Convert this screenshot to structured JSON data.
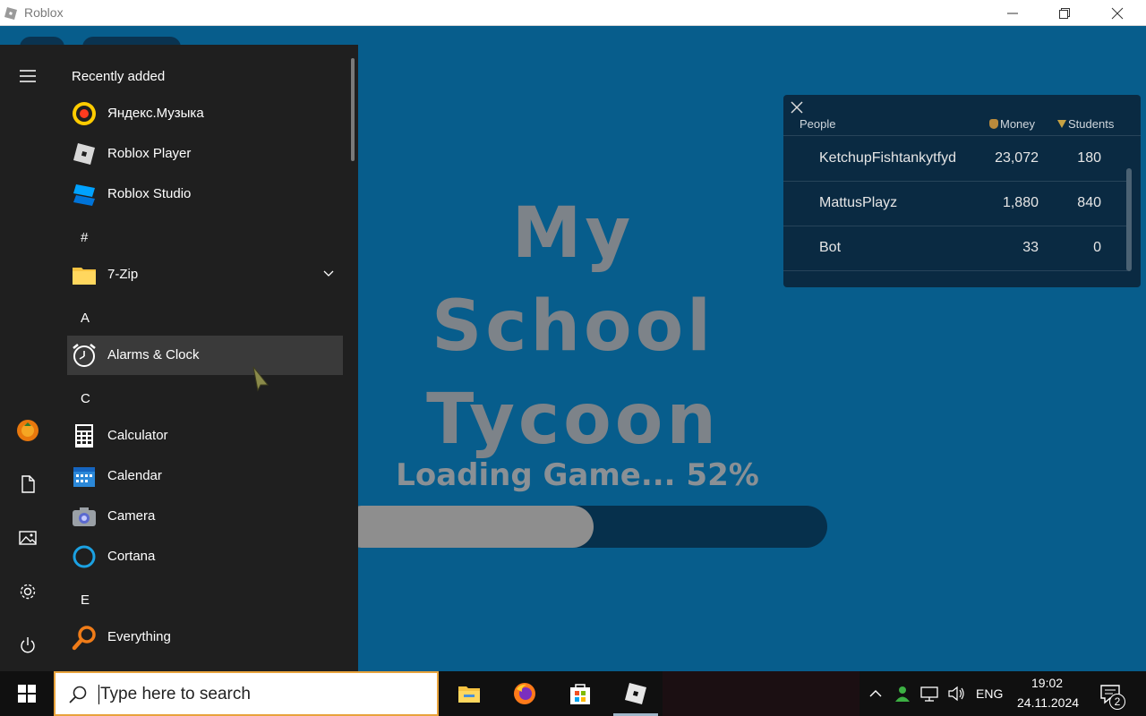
{
  "window": {
    "title": "Roblox",
    "minimize_icon": "minimize-icon",
    "restore_icon": "restore-icon",
    "close_icon": "close-icon"
  },
  "game": {
    "title_line1": "My School",
    "title_line2": "Tycoon",
    "loading_text": "Loading Game... 52%",
    "progress_fraction": 0.52,
    "colors": {
      "background": "#075d8c",
      "progress_fill": "#8e8e8e",
      "progress_track": "#06304c"
    }
  },
  "leaderboard": {
    "headers": {
      "people": "People",
      "money": "Money",
      "students": "Students"
    },
    "rows": [
      {
        "name": "KetchupFishtankytfyd",
        "money": "23,072",
        "students": "180"
      },
      {
        "name": "MattusPlayz",
        "money": "1,880",
        "students": "840"
      },
      {
        "name": "Bot",
        "money": "33",
        "students": "0"
      }
    ]
  },
  "start_menu": {
    "section_title": "Recently added",
    "letters": [
      "#",
      "A",
      "C",
      "E"
    ],
    "apps": [
      {
        "label": "Яндекс.Музыка",
        "icon": "yandex-music-icon"
      },
      {
        "label": "Roblox Player",
        "icon": "roblox-player-icon"
      },
      {
        "label": "Roblox Studio",
        "icon": "roblox-studio-icon"
      },
      {
        "label": "7-Zip",
        "icon": "folder-icon"
      },
      {
        "label": "Alarms & Clock",
        "icon": "alarm-clock-icon"
      },
      {
        "label": "Calculator",
        "icon": "calculator-icon"
      },
      {
        "label": "Calendar",
        "icon": "calendar-icon"
      },
      {
        "label": "Camera",
        "icon": "camera-icon"
      },
      {
        "label": "Cortana",
        "icon": "cortana-icon"
      },
      {
        "label": "Everything",
        "icon": "everything-search-icon"
      }
    ],
    "rail": [
      "hamburger-icon",
      "user-avatar",
      "documents-icon",
      "pictures-icon",
      "settings-icon",
      "power-icon"
    ]
  },
  "taskbar": {
    "search_placeholder": "Type here to search",
    "apps": [
      "file-explorer-icon",
      "firefox-icon",
      "microsoft-store-icon",
      "roblox-icon"
    ],
    "language": "ENG",
    "time": "19:02",
    "date": "24.11.2024",
    "notification_count": "2"
  }
}
